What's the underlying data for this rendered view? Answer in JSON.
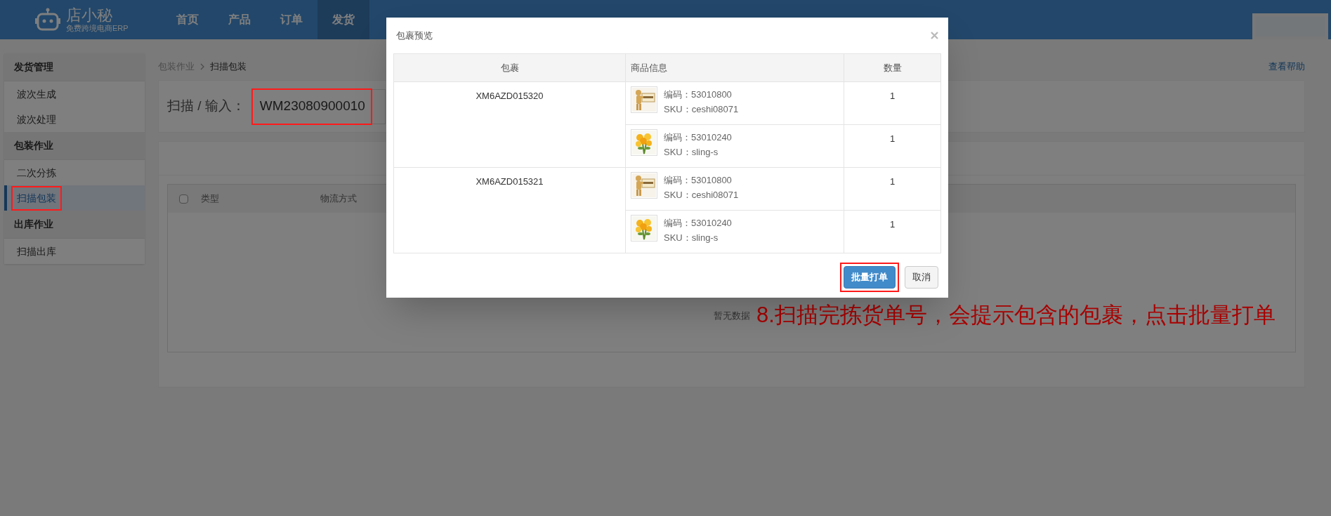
{
  "header": {
    "logo": {
      "name": "店小秘",
      "tagline": "免费跨境电商ERP"
    },
    "nav": [
      {
        "label": "首页",
        "selected": false
      },
      {
        "label": "产品",
        "selected": false
      },
      {
        "label": "订单",
        "selected": false
      },
      {
        "label": "发货",
        "selected": true
      }
    ]
  },
  "sidebar": {
    "sections": [
      {
        "title": "发货管理",
        "items": [
          {
            "label": "波次生成",
            "selected": false,
            "highlighted": false
          },
          {
            "label": "波次处理",
            "selected": false,
            "highlighted": false
          }
        ]
      },
      {
        "title": "包装作业",
        "items": [
          {
            "label": "二次分拣",
            "selected": false,
            "highlighted": false
          },
          {
            "label": "扫描包装",
            "selected": true,
            "highlighted": true
          }
        ]
      },
      {
        "title": "出库作业",
        "items": [
          {
            "label": "扫描出库",
            "selected": false,
            "highlighted": false
          }
        ]
      }
    ]
  },
  "breadcrumb": [
    "包装作业",
    "扫描包装"
  ],
  "help_link": "查看帮助",
  "scan": {
    "label": "扫描 / 输入：",
    "value": "WM23080900010",
    "highlighted": true
  },
  "table": {
    "select_all_checked": false,
    "columns": [
      "类型",
      "物流方式"
    ],
    "empty_text": "暂无数据"
  },
  "dialog": {
    "title": "包裹预览",
    "columns": [
      "包裹",
      "商品信息",
      "数量"
    ],
    "packages": [
      {
        "id": "XM6AZD015320",
        "items": [
          {
            "code": "编码：53010800",
            "sku": "SKU：ceshi08071",
            "quantity": "1"
          },
          {
            "code": "编码：53010240",
            "sku": "SKU：sling-s",
            "quantity": "1"
          }
        ]
      },
      {
        "id": "XM6AZD015321",
        "items": [
          {
            "code": "编码：53010800",
            "sku": "SKU：ceshi08071",
            "quantity": "1"
          },
          {
            "code": "编码：53010240",
            "sku": "SKU：sling-s",
            "quantity": "1"
          }
        ]
      }
    ],
    "buttons": [
      {
        "label": "批量打单",
        "kind": "primary",
        "highlighted": true
      },
      {
        "label": "取消",
        "kind": "default",
        "highlighted": false
      }
    ]
  },
  "annotation": "8.扫描完拣货单号，会提示包含的包裹，点击批量打单"
}
